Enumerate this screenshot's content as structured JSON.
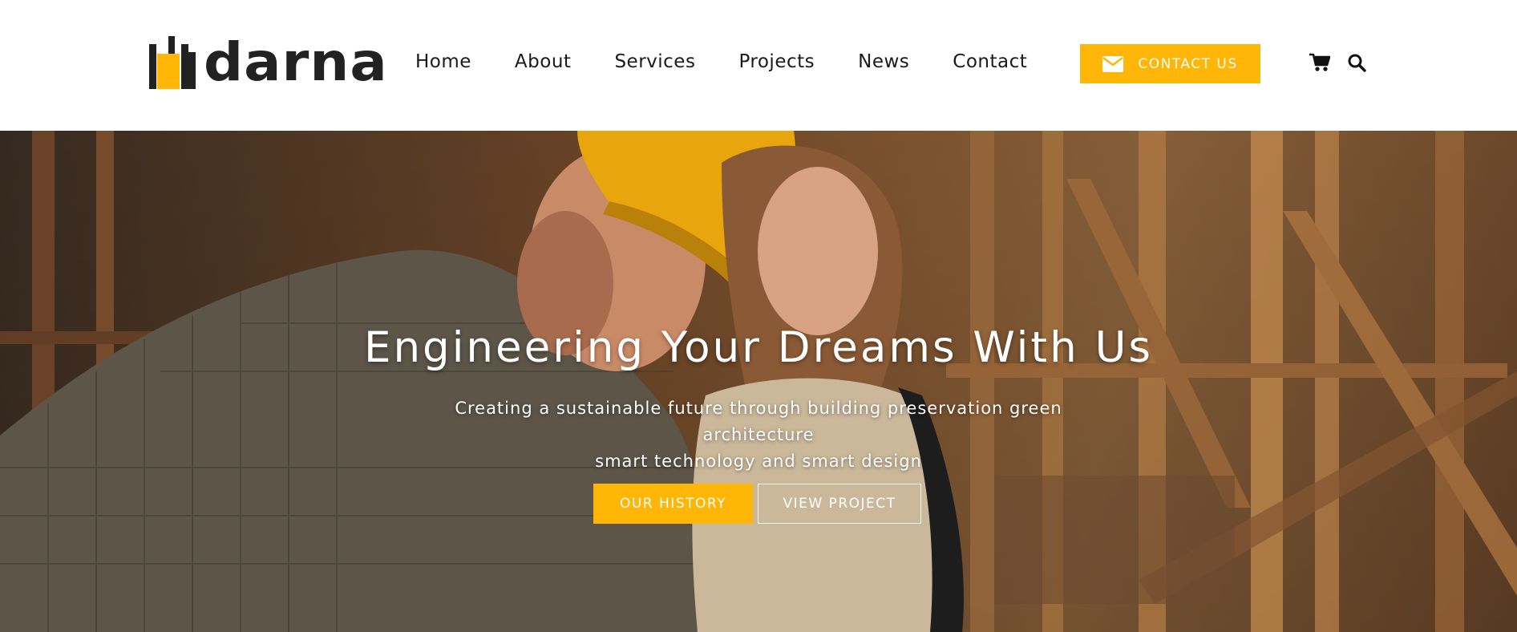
{
  "brand": {
    "name": "darna",
    "accent_color": "#ffb606",
    "logo_icon": "building-logo-icon"
  },
  "nav": {
    "items": [
      {
        "label": "Home"
      },
      {
        "label": "About"
      },
      {
        "label": "Services"
      },
      {
        "label": "Projects"
      },
      {
        "label": "News"
      },
      {
        "label": "Contact"
      }
    ],
    "cta": {
      "label": "CONTACT US",
      "icon": "envelope-icon"
    },
    "icons": {
      "cart": "cart-icon",
      "search": "search-icon"
    }
  },
  "hero": {
    "title": "Engineering Your Dreams With Us",
    "subtitle_line1": "Creating a sustainable future through building preservation green architecture",
    "subtitle_line2": "smart technology and smart design",
    "primary_button": "OUR HISTORY",
    "secondary_button": "VIEW PROJECT"
  }
}
